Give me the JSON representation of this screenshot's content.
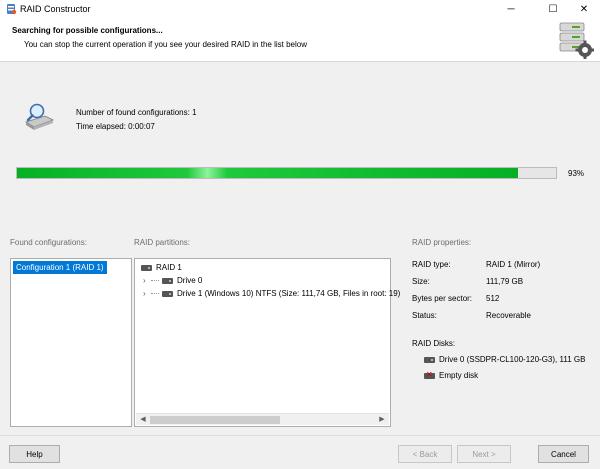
{
  "window": {
    "title": "RAID Constructor",
    "minimize_glyph": "─",
    "maximize_glyph": "☐",
    "close_glyph": "✕"
  },
  "header": {
    "heading": "Searching for possible configurations...",
    "subheading": "You can stop the current operation if you see your desired RAID in the list below"
  },
  "status": {
    "found_configurations": "Number of found configurations: 1",
    "time_elapsed": "Time elapsed: 0:00:07"
  },
  "progress": {
    "value": 0.93,
    "label": "93%"
  },
  "found_configurations": {
    "label": "Found configurations:",
    "items": [
      "Configuration 1 (RAID 1)"
    ],
    "selected": "Configuration 1 (RAID 1)"
  },
  "raid_partitions": {
    "label": "RAID partitions:",
    "root": "RAID 1",
    "drives": [
      "Drive 0",
      "Drive 1 (Windows 10) NTFS (Size: 111,74 GB, Files in root: 19)"
    ]
  },
  "raid_properties": {
    "label": "RAID properties:",
    "rows": [
      {
        "label": "RAID type:",
        "value": "RAID 1 (Mirror)"
      },
      {
        "label": "Size:",
        "value": "111,79 GB"
      },
      {
        "label": "Bytes per sector:",
        "value": "512"
      },
      {
        "label": "Status:",
        "value": "Recoverable"
      }
    ],
    "disks_label": "RAID Disks:",
    "disks": [
      "Drive 0 (SSDPR-CL100-120-G3), 111 GB",
      "Empty disk"
    ]
  },
  "buttons": {
    "help": "Help",
    "back": "< Back",
    "next": "Next >",
    "cancel": "Cancel"
  },
  "colors": {
    "progress": "#06b025",
    "selection": "#0078d7"
  }
}
